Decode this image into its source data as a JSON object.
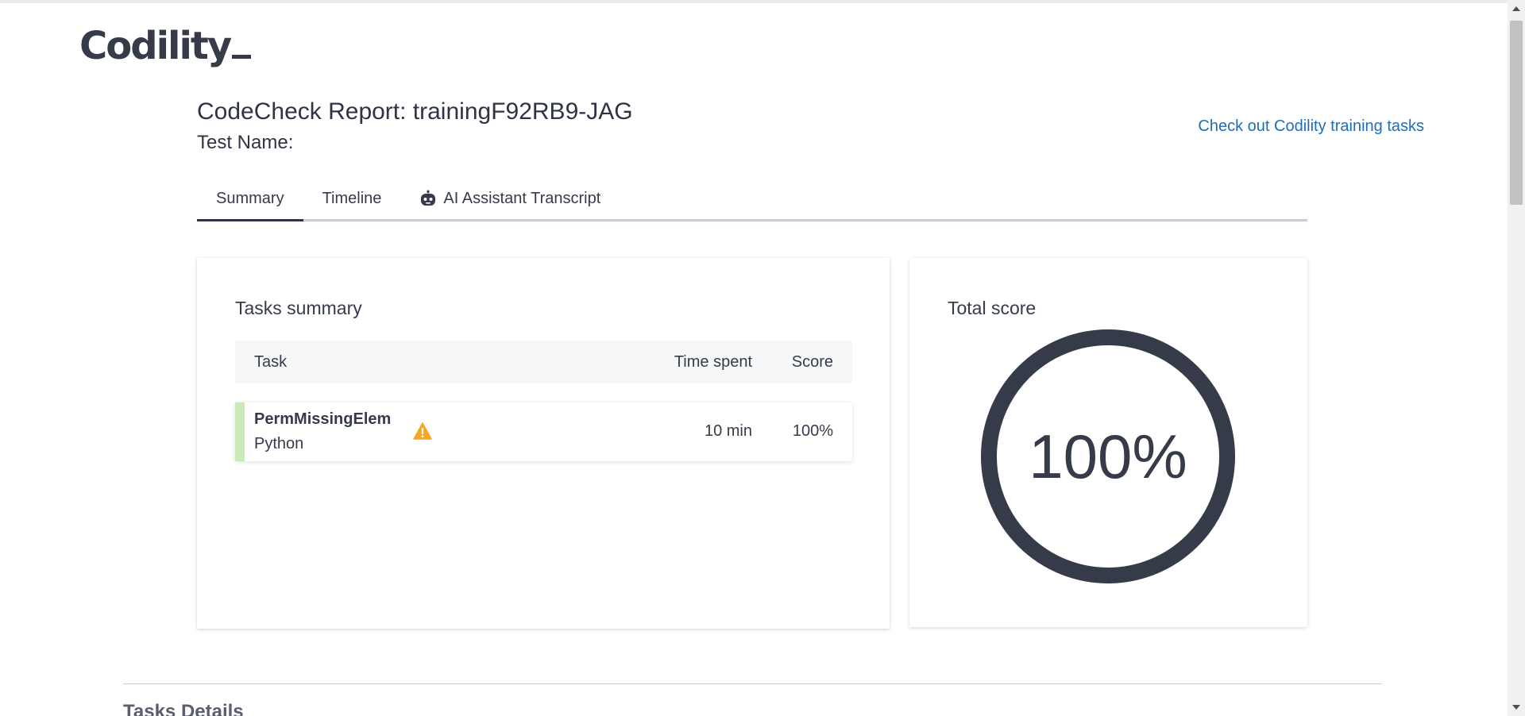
{
  "brand": {
    "logo_text": "Codility",
    "color": "#363b4a"
  },
  "header": {
    "title": "CodeCheck Report: trainingF92RB9-JAG",
    "test_name_label": "Test Name:",
    "training_link": "Check out Codility training tasks",
    "link_color": "#1f6eb5"
  },
  "tabs": [
    {
      "label": "Summary",
      "active": true
    },
    {
      "label": "Timeline",
      "active": false
    },
    {
      "label": "AI Assistant Transcript",
      "active": false,
      "icon": "robot-icon"
    }
  ],
  "tasks_summary": {
    "title": "Tasks summary",
    "columns": {
      "task": "Task",
      "time": "Time spent",
      "score": "Score"
    },
    "rows": [
      {
        "name": "PermMissingElem",
        "language": "Python",
        "warning_icon": "warning-icon",
        "time_spent": "10 min",
        "score": "100%",
        "status_color": "#c8ebb8"
      }
    ]
  },
  "total_score": {
    "title": "Total score",
    "value_text": "100%",
    "fraction": 1.0
  },
  "details": {
    "title": "Tasks Details"
  },
  "colors": {
    "warning": "#f5a623",
    "ring": "#363b4a"
  }
}
